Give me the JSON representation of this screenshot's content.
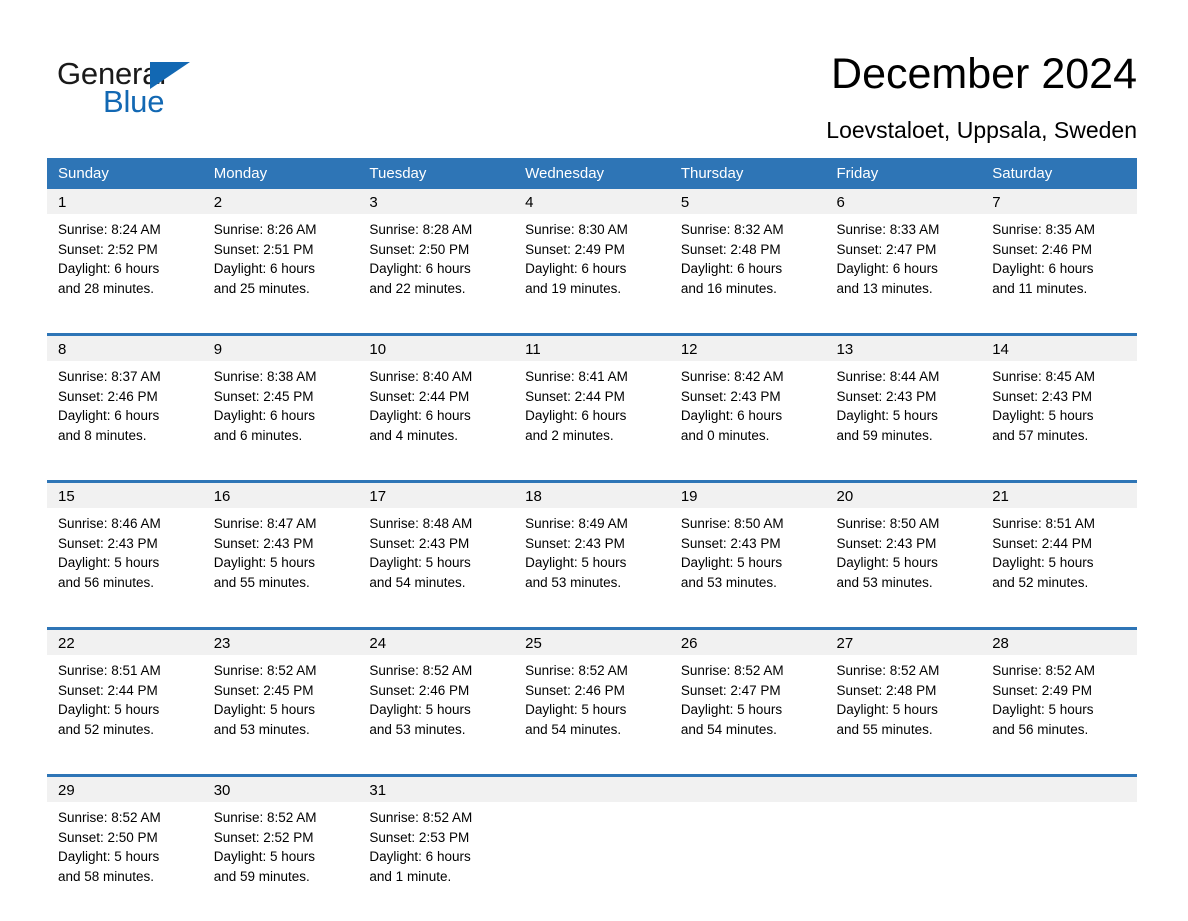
{
  "brand": {
    "name_part1": "General",
    "name_part2": "Blue",
    "triangle_color": "#1268b3"
  },
  "header": {
    "title": "December 2024",
    "subtitle": "Loevstaloet, Uppsala, Sweden"
  },
  "theme": {
    "header_blue": "#2e75b6",
    "daynum_band": "#f1f1f1",
    "page_background": "#ffffff",
    "text": "#000000"
  },
  "calendar": {
    "weekday_headers": [
      "Sunday",
      "Monday",
      "Tuesday",
      "Wednesday",
      "Thursday",
      "Friday",
      "Saturday"
    ],
    "weeks": [
      {
        "days": [
          {
            "num": "1",
            "sunrise": "Sunrise: 8:24 AM",
            "sunset": "Sunset: 2:52 PM",
            "daylight_line1": "Daylight: 6 hours",
            "daylight_line2": "and 28 minutes."
          },
          {
            "num": "2",
            "sunrise": "Sunrise: 8:26 AM",
            "sunset": "Sunset: 2:51 PM",
            "daylight_line1": "Daylight: 6 hours",
            "daylight_line2": "and 25 minutes."
          },
          {
            "num": "3",
            "sunrise": "Sunrise: 8:28 AM",
            "sunset": "Sunset: 2:50 PM",
            "daylight_line1": "Daylight: 6 hours",
            "daylight_line2": "and 22 minutes."
          },
          {
            "num": "4",
            "sunrise": "Sunrise: 8:30 AM",
            "sunset": "Sunset: 2:49 PM",
            "daylight_line1": "Daylight: 6 hours",
            "daylight_line2": "and 19 minutes."
          },
          {
            "num": "5",
            "sunrise": "Sunrise: 8:32 AM",
            "sunset": "Sunset: 2:48 PM",
            "daylight_line1": "Daylight: 6 hours",
            "daylight_line2": "and 16 minutes."
          },
          {
            "num": "6",
            "sunrise": "Sunrise: 8:33 AM",
            "sunset": "Sunset: 2:47 PM",
            "daylight_line1": "Daylight: 6 hours",
            "daylight_line2": "and 13 minutes."
          },
          {
            "num": "7",
            "sunrise": "Sunrise: 8:35 AM",
            "sunset": "Sunset: 2:46 PM",
            "daylight_line1": "Daylight: 6 hours",
            "daylight_line2": "and 11 minutes."
          }
        ]
      },
      {
        "days": [
          {
            "num": "8",
            "sunrise": "Sunrise: 8:37 AM",
            "sunset": "Sunset: 2:46 PM",
            "daylight_line1": "Daylight: 6 hours",
            "daylight_line2": "and 8 minutes."
          },
          {
            "num": "9",
            "sunrise": "Sunrise: 8:38 AM",
            "sunset": "Sunset: 2:45 PM",
            "daylight_line1": "Daylight: 6 hours",
            "daylight_line2": "and 6 minutes."
          },
          {
            "num": "10",
            "sunrise": "Sunrise: 8:40 AM",
            "sunset": "Sunset: 2:44 PM",
            "daylight_line1": "Daylight: 6 hours",
            "daylight_line2": "and 4 minutes."
          },
          {
            "num": "11",
            "sunrise": "Sunrise: 8:41 AM",
            "sunset": "Sunset: 2:44 PM",
            "daylight_line1": "Daylight: 6 hours",
            "daylight_line2": "and 2 minutes."
          },
          {
            "num": "12",
            "sunrise": "Sunrise: 8:42 AM",
            "sunset": "Sunset: 2:43 PM",
            "daylight_line1": "Daylight: 6 hours",
            "daylight_line2": "and 0 minutes."
          },
          {
            "num": "13",
            "sunrise": "Sunrise: 8:44 AM",
            "sunset": "Sunset: 2:43 PM",
            "daylight_line1": "Daylight: 5 hours",
            "daylight_line2": "and 59 minutes."
          },
          {
            "num": "14",
            "sunrise": "Sunrise: 8:45 AM",
            "sunset": "Sunset: 2:43 PM",
            "daylight_line1": "Daylight: 5 hours",
            "daylight_line2": "and 57 minutes."
          }
        ]
      },
      {
        "days": [
          {
            "num": "15",
            "sunrise": "Sunrise: 8:46 AM",
            "sunset": "Sunset: 2:43 PM",
            "daylight_line1": "Daylight: 5 hours",
            "daylight_line2": "and 56 minutes."
          },
          {
            "num": "16",
            "sunrise": "Sunrise: 8:47 AM",
            "sunset": "Sunset: 2:43 PM",
            "daylight_line1": "Daylight: 5 hours",
            "daylight_line2": "and 55 minutes."
          },
          {
            "num": "17",
            "sunrise": "Sunrise: 8:48 AM",
            "sunset": "Sunset: 2:43 PM",
            "daylight_line1": "Daylight: 5 hours",
            "daylight_line2": "and 54 minutes."
          },
          {
            "num": "18",
            "sunrise": "Sunrise: 8:49 AM",
            "sunset": "Sunset: 2:43 PM",
            "daylight_line1": "Daylight: 5 hours",
            "daylight_line2": "and 53 minutes."
          },
          {
            "num": "19",
            "sunrise": "Sunrise: 8:50 AM",
            "sunset": "Sunset: 2:43 PM",
            "daylight_line1": "Daylight: 5 hours",
            "daylight_line2": "and 53 minutes."
          },
          {
            "num": "20",
            "sunrise": "Sunrise: 8:50 AM",
            "sunset": "Sunset: 2:43 PM",
            "daylight_line1": "Daylight: 5 hours",
            "daylight_line2": "and 53 minutes."
          },
          {
            "num": "21",
            "sunrise": "Sunrise: 8:51 AM",
            "sunset": "Sunset: 2:44 PM",
            "daylight_line1": "Daylight: 5 hours",
            "daylight_line2": "and 52 minutes."
          }
        ]
      },
      {
        "days": [
          {
            "num": "22",
            "sunrise": "Sunrise: 8:51 AM",
            "sunset": "Sunset: 2:44 PM",
            "daylight_line1": "Daylight: 5 hours",
            "daylight_line2": "and 52 minutes."
          },
          {
            "num": "23",
            "sunrise": "Sunrise: 8:52 AM",
            "sunset": "Sunset: 2:45 PM",
            "daylight_line1": "Daylight: 5 hours",
            "daylight_line2": "and 53 minutes."
          },
          {
            "num": "24",
            "sunrise": "Sunrise: 8:52 AM",
            "sunset": "Sunset: 2:46 PM",
            "daylight_line1": "Daylight: 5 hours",
            "daylight_line2": "and 53 minutes."
          },
          {
            "num": "25",
            "sunrise": "Sunrise: 8:52 AM",
            "sunset": "Sunset: 2:46 PM",
            "daylight_line1": "Daylight: 5 hours",
            "daylight_line2": "and 54 minutes."
          },
          {
            "num": "26",
            "sunrise": "Sunrise: 8:52 AM",
            "sunset": "Sunset: 2:47 PM",
            "daylight_line1": "Daylight: 5 hours",
            "daylight_line2": "and 54 minutes."
          },
          {
            "num": "27",
            "sunrise": "Sunrise: 8:52 AM",
            "sunset": "Sunset: 2:48 PM",
            "daylight_line1": "Daylight: 5 hours",
            "daylight_line2": "and 55 minutes."
          },
          {
            "num": "28",
            "sunrise": "Sunrise: 8:52 AM",
            "sunset": "Sunset: 2:49 PM",
            "daylight_line1": "Daylight: 5 hours",
            "daylight_line2": "and 56 minutes."
          }
        ]
      },
      {
        "days": [
          {
            "num": "29",
            "sunrise": "Sunrise: 8:52 AM",
            "sunset": "Sunset: 2:50 PM",
            "daylight_line1": "Daylight: 5 hours",
            "daylight_line2": "and 58 minutes."
          },
          {
            "num": "30",
            "sunrise": "Sunrise: 8:52 AM",
            "sunset": "Sunset: 2:52 PM",
            "daylight_line1": "Daylight: 5 hours",
            "daylight_line2": "and 59 minutes."
          },
          {
            "num": "31",
            "sunrise": "Sunrise: 8:52 AM",
            "sunset": "Sunset: 2:53 PM",
            "daylight_line1": "Daylight: 6 hours",
            "daylight_line2": "and 1 minute."
          },
          {
            "num": "",
            "sunrise": "",
            "sunset": "",
            "daylight_line1": "",
            "daylight_line2": ""
          },
          {
            "num": "",
            "sunrise": "",
            "sunset": "",
            "daylight_line1": "",
            "daylight_line2": ""
          },
          {
            "num": "",
            "sunrise": "",
            "sunset": "",
            "daylight_line1": "",
            "daylight_line2": ""
          },
          {
            "num": "",
            "sunrise": "",
            "sunset": "",
            "daylight_line1": "",
            "daylight_line2": ""
          }
        ]
      }
    ]
  }
}
